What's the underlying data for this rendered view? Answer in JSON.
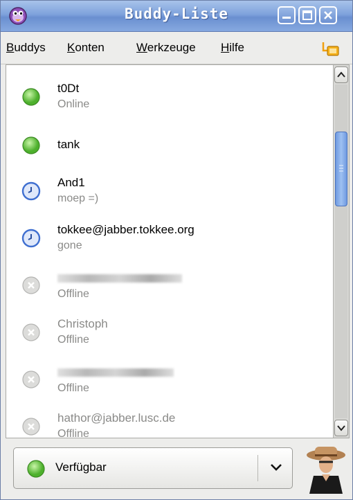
{
  "window": {
    "title": "Buddy-Liste"
  },
  "menu": [
    {
      "label_ul": "B",
      "label_rest": "uddys"
    },
    {
      "label_ul": "K",
      "label_rest": "onten"
    },
    {
      "label_ul": "W",
      "label_rest": "erkzeuge"
    },
    {
      "label_ul": "H",
      "label_rest": "ilfe"
    }
  ],
  "buddies": [
    {
      "name": "t0Dt",
      "status": "Online",
      "state": "available"
    },
    {
      "name": "tank",
      "status": "",
      "state": "available"
    },
    {
      "name": "And1",
      "status": "moep =)",
      "state": "away"
    },
    {
      "name": "tokkee@jabber.tokkee.org",
      "status": "gone",
      "state": "away"
    },
    {
      "name": "",
      "status": "Offline",
      "state": "offline",
      "redacted": true
    },
    {
      "name": "Christoph",
      "status": "Offline",
      "state": "offline"
    },
    {
      "name": "",
      "status": "Offline",
      "state": "offline",
      "redacted": true
    },
    {
      "name": "hathor@jabber.lusc.de",
      "status": "Offline",
      "state": "offline"
    }
  ],
  "status_selector": {
    "label": "Verfügbar",
    "icon": "available-status-icon"
  },
  "colors": {
    "titlebar": "#7ea2dc",
    "available": "#5cc83a",
    "away": "#3f6fd0",
    "offline": "#b0b0ae"
  }
}
